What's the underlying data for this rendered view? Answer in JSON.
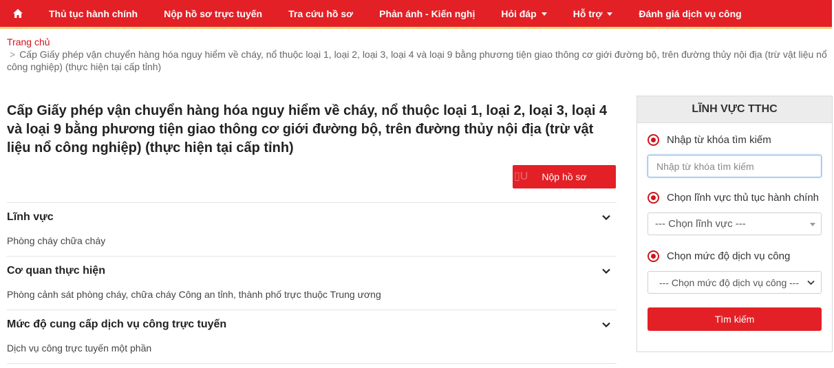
{
  "nav": {
    "home_icon": "home-icon",
    "items": [
      {
        "label": "Thủ tục hành chính",
        "dropdown": false
      },
      {
        "label": "Nộp hồ sơ trực tuyến",
        "dropdown": false
      },
      {
        "label": "Tra cứu hồ sơ",
        "dropdown": false
      },
      {
        "label": "Phản ánh - Kiến nghị",
        "dropdown": false
      },
      {
        "label": "Hỏi đáp",
        "dropdown": true
      },
      {
        "label": "Hỗ trợ",
        "dropdown": true
      },
      {
        "label": "Đánh giá dịch vụ công",
        "dropdown": false
      }
    ]
  },
  "breadcrumb": {
    "home": "Trang chủ",
    "separator": ">",
    "current": "Cấp Giấy phép vận chuyển hàng hóa nguy hiểm về cháy, nổ thuộc loại 1, loại 2, loại 3, loại 4 và loại 9 bằng phương tiện giao thông cơ giới đường bộ, trên đường thủy nội địa (trừ vật liệu nổ công nghiệp) (thực hiện tại cấp tỉnh)"
  },
  "main": {
    "title": "Cấp Giấy phép vận chuyển hàng hóa nguy hiểm về cháy, nổ thuộc loại 1, loại 2, loại 3, loại 4 và loại 9 bằng phương tiện giao thông cơ giới đường bộ, trên đường thủy nội địa (trừ vật liệu nổ công nghiệp) (thực hiện tại cấp tỉnh)",
    "submit_label": "Nộp hồ sơ",
    "sections": [
      {
        "heading": "Lĩnh vực",
        "value": "Phòng cháy chữa cháy"
      },
      {
        "heading": "Cơ quan thực hiện",
        "value": "Phòng cảnh sát phòng cháy, chữa cháy Công an tỉnh, thành phố trực thuộc Trung ương"
      },
      {
        "heading": "Mức độ cung cấp dịch vụ công trực tuyến",
        "value": "Dịch vụ công trực tuyến một phần"
      }
    ]
  },
  "sidebar": {
    "title": "LĨNH VỰC TTHC",
    "keyword_label": "Nhập từ khóa tìm kiếm",
    "keyword_placeholder": "Nhập từ khóa tìm kiếm",
    "field_label": "Chọn lĩnh vực thủ tục hành chính",
    "field_selected": "--- Chọn lĩnh vực ---",
    "level_label": "Chọn mức độ dịch vụ công",
    "level_selected": "--- Chọn mức độ dịch vụ công ---",
    "search_label": "Tìm kiếm"
  },
  "colors": {
    "brand_red": "#e32026",
    "nav_accent": "#f3d27a",
    "link_red": "#d0141d"
  }
}
